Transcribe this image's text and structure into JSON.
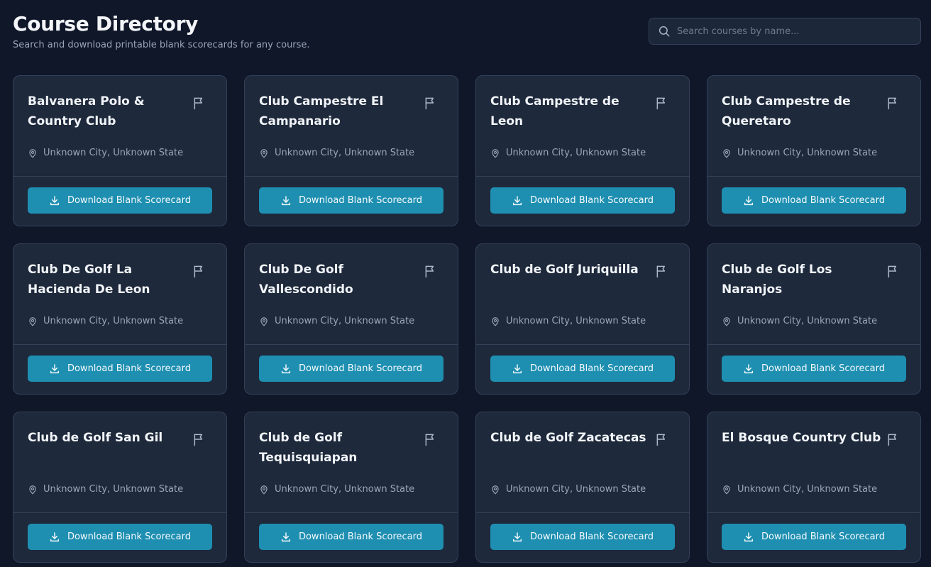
{
  "header": {
    "title": "Course Directory",
    "subtitle": "Search and download printable blank scorecards for any course."
  },
  "search": {
    "placeholder": "Search courses by name...",
    "value": ""
  },
  "colors": {
    "background": "#0f1729",
    "card": "#1e293b",
    "accent": "#1e8fb1"
  },
  "icons": {
    "search": "search-icon",
    "flag": "flag-icon",
    "location": "map-pin-icon",
    "download": "download-icon"
  },
  "courses": [
    {
      "name": "Balvanera Polo & Country Club",
      "location": "Unknown City, Unknown State",
      "button_label": "Download Blank Scorecard"
    },
    {
      "name": "Club Campestre El Campanario",
      "location": "Unknown City, Unknown State",
      "button_label": "Download Blank Scorecard"
    },
    {
      "name": "Club Campestre de Leon",
      "location": "Unknown City, Unknown State",
      "button_label": "Download Blank Scorecard"
    },
    {
      "name": "Club Campestre de Queretaro",
      "location": "Unknown City, Unknown State",
      "button_label": "Download Blank Scorecard"
    },
    {
      "name": "Club De Golf La Hacienda De Leon",
      "location": "Unknown City, Unknown State",
      "button_label": "Download Blank Scorecard"
    },
    {
      "name": "Club De Golf Vallescondido",
      "location": "Unknown City, Unknown State",
      "button_label": "Download Blank Scorecard"
    },
    {
      "name": "Club de Golf Juriquilla",
      "location": "Unknown City, Unknown State",
      "button_label": "Download Blank Scorecard"
    },
    {
      "name": "Club de Golf Los Naranjos",
      "location": "Unknown City, Unknown State",
      "button_label": "Download Blank Scorecard"
    },
    {
      "name": "Club de Golf San Gil",
      "location": "Unknown City, Unknown State",
      "button_label": "Download Blank Scorecard"
    },
    {
      "name": "Club de Golf Tequisquiapan",
      "location": "Unknown City, Unknown State",
      "button_label": "Download Blank Scorecard"
    },
    {
      "name": "Club de Golf Zacatecas",
      "location": "Unknown City, Unknown State",
      "button_label": "Download Blank Scorecard"
    },
    {
      "name": "El Bosque Country Club",
      "location": "Unknown City, Unknown State",
      "button_label": "Download Blank Scorecard"
    }
  ]
}
